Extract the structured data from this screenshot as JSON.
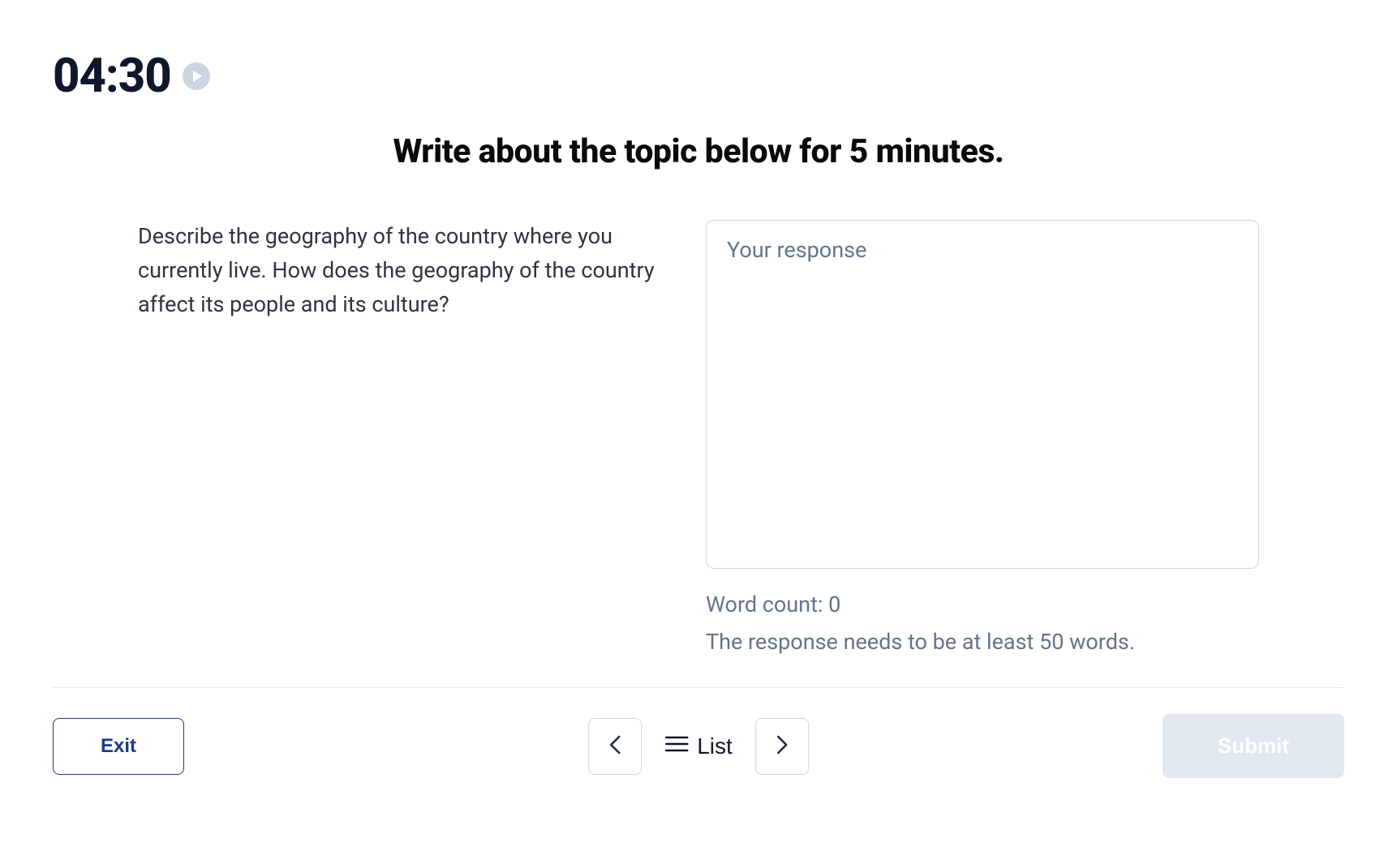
{
  "timer": {
    "display": "04:30"
  },
  "heading": "Write about the topic below for 5 minutes.",
  "prompt": "Describe the geography of the country where you currently live. How does the geography of the country affect its people and its culture?",
  "response": {
    "placeholder": "Your response",
    "value": ""
  },
  "word_count": {
    "label": "Word count: ",
    "value": "0"
  },
  "min_words_message": "The response needs to be at least 50 words.",
  "buttons": {
    "exit": "Exit",
    "list": "List",
    "submit": "Submit"
  }
}
